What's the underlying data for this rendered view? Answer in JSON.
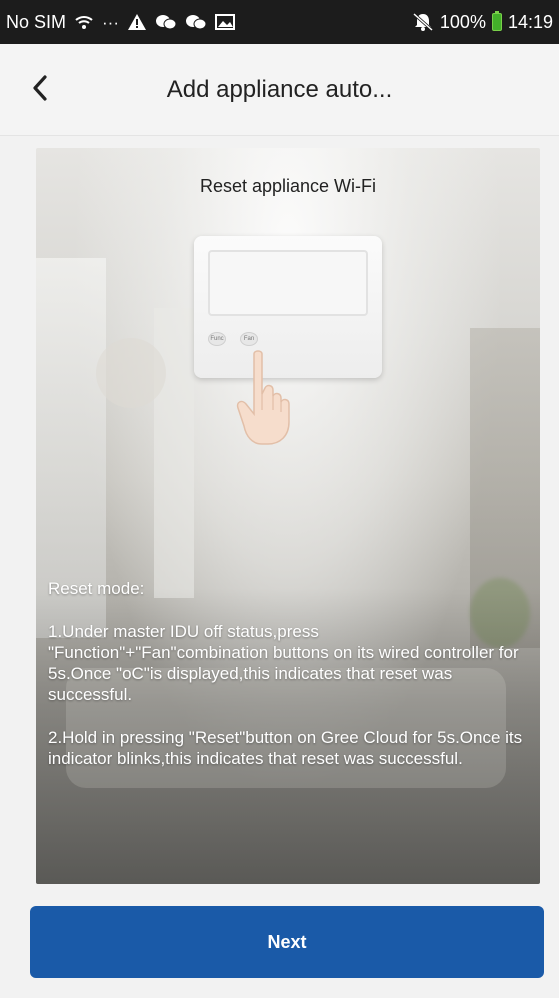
{
  "status_bar": {
    "carrier": "No SIM",
    "dots": "···",
    "battery_percent": "100%",
    "time": "14:19",
    "icons": [
      "wifi-icon",
      "warning-icon",
      "wechat-icon",
      "wechat-icon",
      "image-icon",
      "mute-icon",
      "battery-icon"
    ]
  },
  "header": {
    "title": "Add appliance auto...",
    "back_icon": "chevron-left-icon"
  },
  "card": {
    "title": "Reset appliance Wi-Fi",
    "controller_buttons": [
      "Func",
      "Fan"
    ],
    "reset_mode_label": "Reset mode:",
    "step1": "1.Under master IDU off status,press \"Function\"+\"Fan\"combination buttons on its wired controller for 5s.Once \"oC\"is displayed,this indicates that reset was successful.",
    "step2": "2.Hold in pressing \"Reset\"button on Gree Cloud for 5s.Once its indicator blinks,this indicates that reset was successful."
  },
  "footer": {
    "next_label": "Next"
  },
  "colors": {
    "status_bar_bg": "#1c1c1c",
    "primary_button": "#1a5aa8",
    "battery": "#43b02a"
  }
}
